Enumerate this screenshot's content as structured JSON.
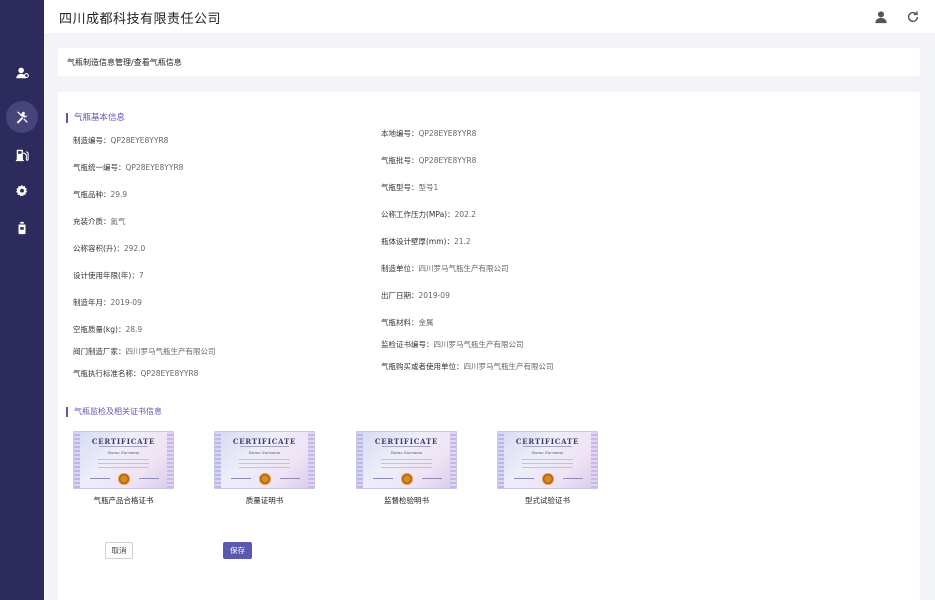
{
  "header": {
    "company": "四川成都科技有限责任公司"
  },
  "icons": {
    "nav": [
      "user-icon",
      "tools-icon",
      "gas-station-icon",
      "gear-icon",
      "cylinder-icon"
    ],
    "top": [
      "user-avatar-icon",
      "refresh-icon"
    ]
  },
  "colors": {
    "sidebar": "#2d2b5e",
    "accent": "#5b58b0"
  },
  "breadcrumb": "气瓶制造信息管理/查看气瓶信息",
  "basic": {
    "title": "气瓶基本信息",
    "left": [
      {
        "label": "制造编号：",
        "value": "QP28EYE8YYR8"
      },
      {
        "label": "气瓶统一编号：",
        "value": "QP28EYE8YYR8"
      },
      {
        "label": "气瓶品种：",
        "value": "29.9"
      },
      {
        "label": "充装介质：",
        "value": "氮气"
      },
      {
        "label": "公称容积(升)：",
        "value": "292.0"
      },
      {
        "label": "设计使用年限(年)：",
        "value": "7"
      },
      {
        "label": "制造年月：",
        "value": "2019-09"
      },
      {
        "label": "空瓶质量(kg)：",
        "value": "28.9"
      },
      {
        "label": "阀门制造厂家：",
        "value": "四川罗马气瓶生产有限公司"
      },
      {
        "label": "气瓶执行标准名称：",
        "value": "QP28EYE8YYR8"
      }
    ],
    "right": [
      {
        "label": "本地编号：",
        "value": "QP28EYE8YYR8"
      },
      {
        "label": "气瓶批号：",
        "value": "QP28EYE8YYR8"
      },
      {
        "label": "气瓶型号：",
        "value": "型号1"
      },
      {
        "label": "公称工作压力(MPa)：",
        "value": "202.2"
      },
      {
        "label": "瓶体设计壁厚(mm)：",
        "value": "21.2"
      },
      {
        "label": "制造单位：",
        "value": "四川罗马气瓶生产有限公司"
      },
      {
        "label": "出厂日期：",
        "value": "2019-09"
      },
      {
        "label": "气瓶材料：",
        "value": "金属"
      },
      {
        "label": "监检证书编号：",
        "value": "四川罗马气瓶生产有限公司"
      },
      {
        "label": "气瓶购买或者使用单位：",
        "value": "四川罗马气瓶生产有限公司"
      }
    ]
  },
  "certs": {
    "title": "气瓶监检及相关证书信息",
    "items": [
      {
        "title": "CERTIFICATE",
        "name": "Name Surname",
        "label": "气瓶产品合格证书"
      },
      {
        "title": "CERTIFICATE",
        "name": "Name Surname",
        "label": "质量证明书"
      },
      {
        "title": "CERTIFICATE",
        "name": "Name Surname",
        "label": "监督检验明书"
      },
      {
        "title": "CERTIFICATE",
        "name": "Name Surname",
        "label": "型式试验证书"
      }
    ]
  },
  "buttons": {
    "cancel": "取消",
    "save": "保存"
  }
}
